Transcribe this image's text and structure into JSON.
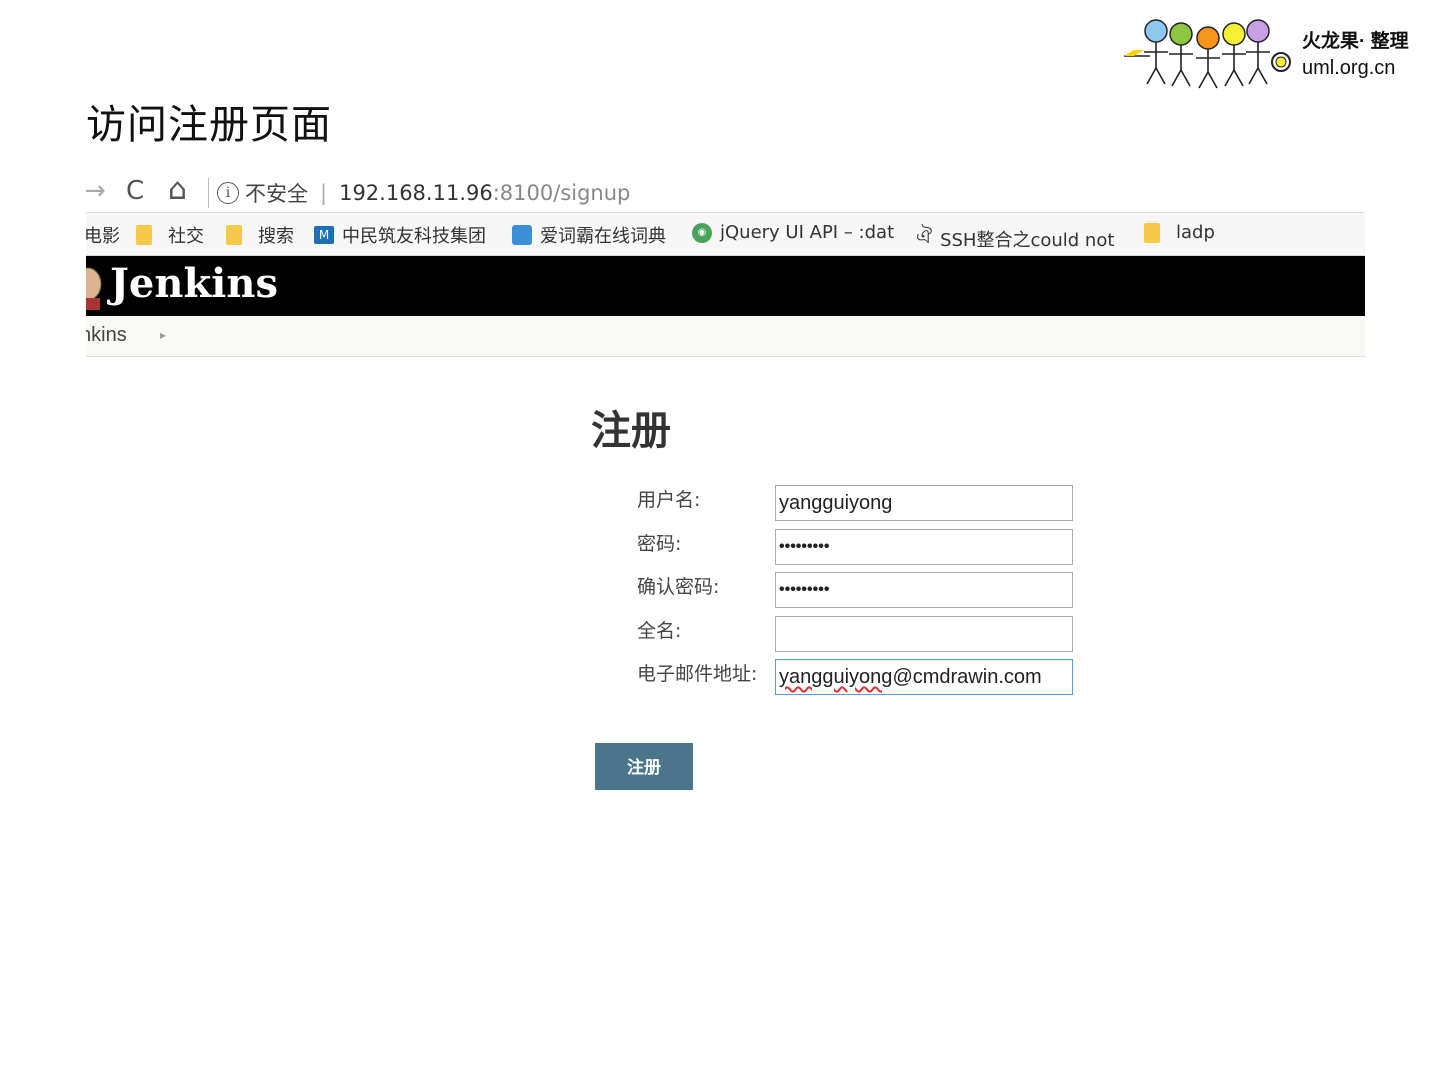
{
  "slide": {
    "title": "访问注册页面",
    "logo_line1": "火龙果· 整理",
    "logo_line2": "uml.org.cn"
  },
  "browser": {
    "nav": {
      "forward": "→",
      "reload": "C",
      "home": "⌂"
    },
    "address": {
      "info": "i",
      "security": "不安全",
      "host": "192.168.11.96",
      "path": ":8100/signup"
    },
    "bookmarks": [
      {
        "label": "电影",
        "icon": "folder-icon"
      },
      {
        "label": "社交",
        "icon": "folder-icon"
      },
      {
        "label": "搜索",
        "icon": "folder-icon"
      },
      {
        "label": "中民筑友科技集团",
        "icon": "blue-square-icon"
      },
      {
        "label": "爱词霸在线词典",
        "icon": "dictionary-icon"
      },
      {
        "label": "jQuery UI API – :dat",
        "icon": "green-circle-icon"
      },
      {
        "label": "SSH整合之could not",
        "icon": "script-icon"
      },
      {
        "label": "ladp",
        "icon": "folder-icon"
      }
    ]
  },
  "jenkins": {
    "title": "Jenkins",
    "breadcrumb": "nkins",
    "breadcrumb_arrow": "▸"
  },
  "form": {
    "title": "注册",
    "fields": [
      {
        "label": "用户名:",
        "value": "yangguiyong"
      },
      {
        "label": "密码:",
        "value": "•••••••••"
      },
      {
        "label": "确认密码:",
        "value": "•••••••••"
      },
      {
        "label": "全名:",
        "value": ""
      },
      {
        "label": "电子邮件地址:",
        "value_user": "yangguiyong",
        "value_domain": "@cmdrawin.com"
      }
    ],
    "submit_label": "注册"
  }
}
